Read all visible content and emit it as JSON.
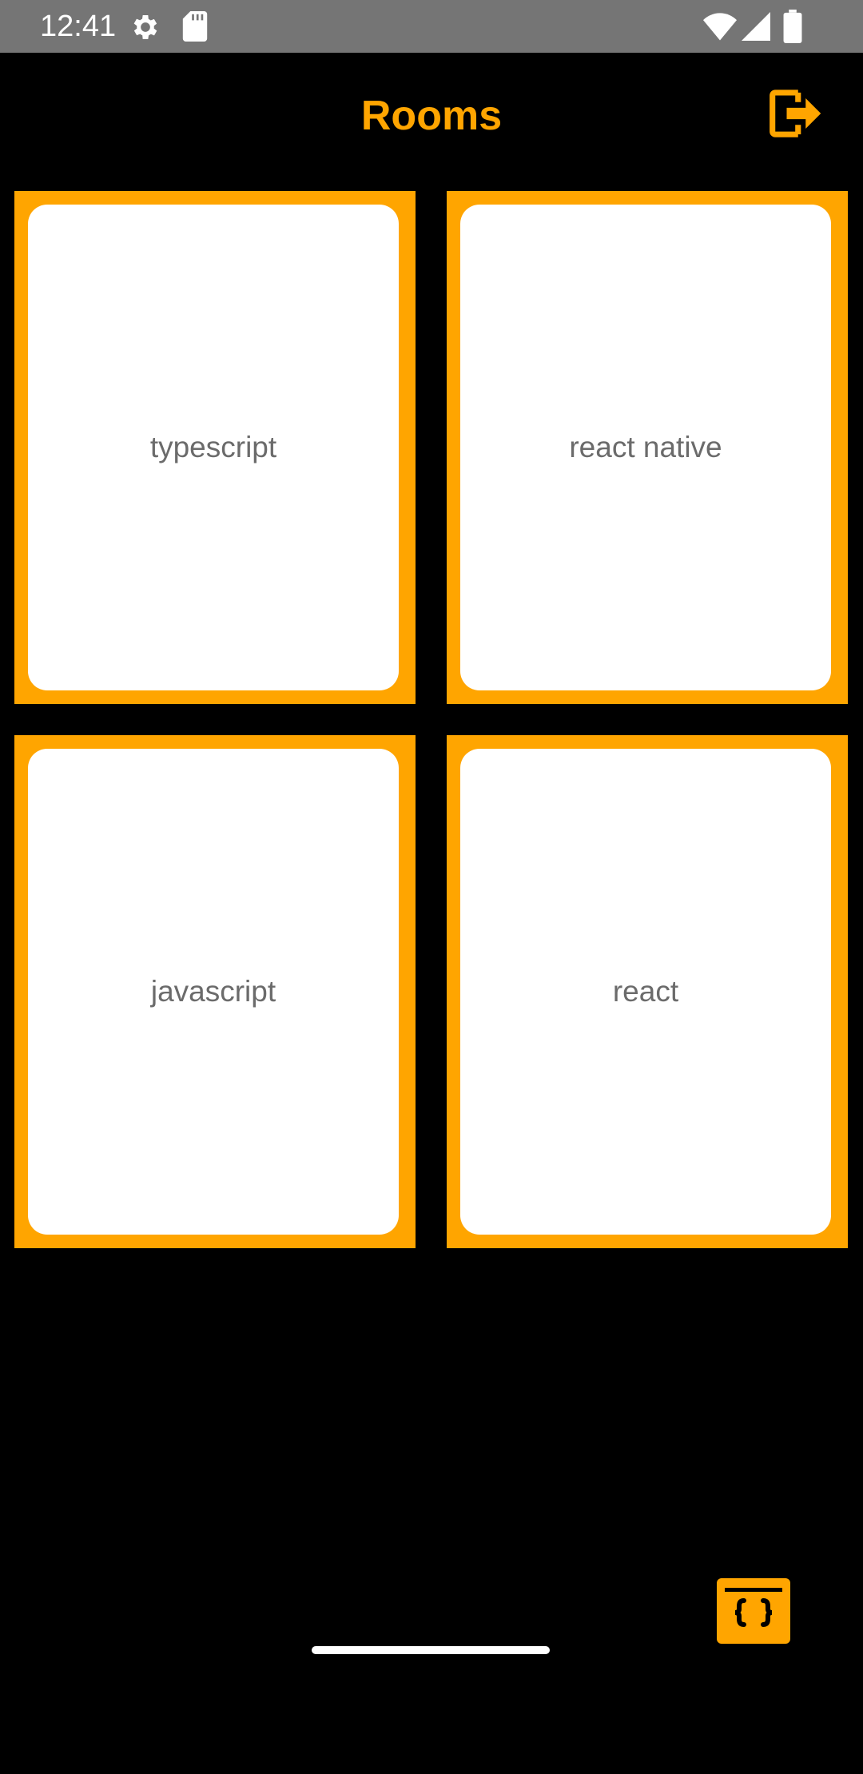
{
  "status_bar": {
    "time": "12:41",
    "icons": [
      "settings-gear-icon",
      "sd-card-icon",
      "wifi-icon",
      "cell-signal-icon",
      "battery-icon"
    ]
  },
  "header": {
    "title": "Rooms",
    "logout_icon": "logout-icon"
  },
  "rooms": [
    {
      "label": "typescript"
    },
    {
      "label": "react native"
    },
    {
      "label": "javascript"
    },
    {
      "label": "react"
    }
  ],
  "fab": {
    "icon": "code-window-icon"
  },
  "colors": {
    "accent": "#FFA500",
    "background": "#000000",
    "card": "#FFFFFF",
    "card_text": "#6B6B6B",
    "status_bar": "#757575"
  }
}
